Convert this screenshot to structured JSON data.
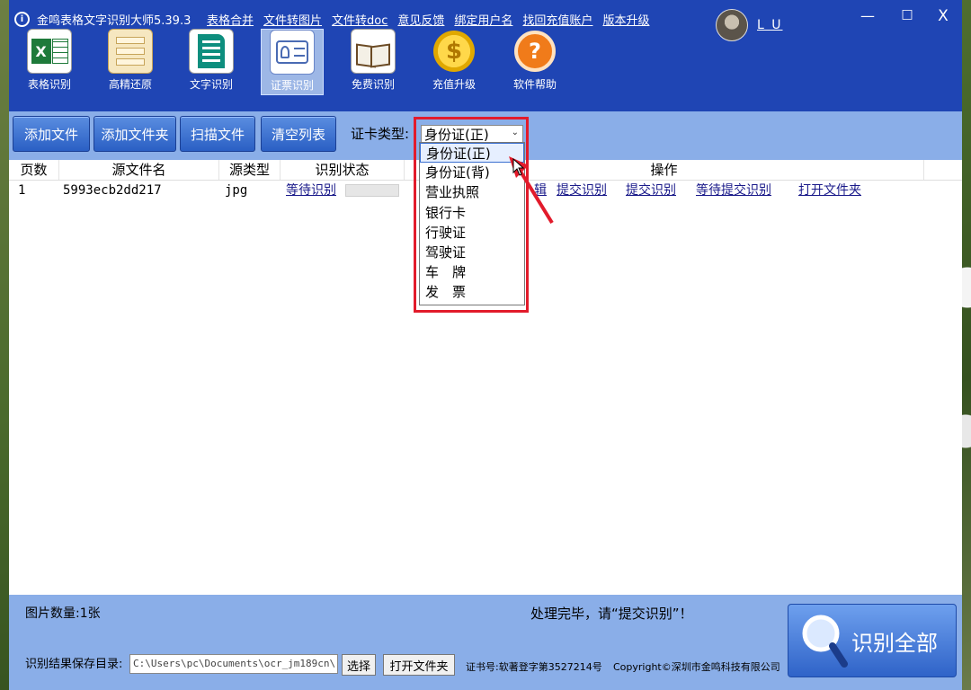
{
  "app": {
    "title": "金鸣表格文字识别大师5.39.3",
    "logo_glyph": "i"
  },
  "menu_links": [
    "表格合并",
    "文件转图片",
    "文件转doc",
    "意见反馈",
    "绑定用户名",
    "找回充值账户",
    "版本升级"
  ],
  "user": {
    "name": "L U"
  },
  "window_controls": {
    "minimize": "—",
    "maximize": "□",
    "close": "X"
  },
  "tools": [
    {
      "label": "表格识别",
      "icon": "excel-icon"
    },
    {
      "label": "高精还原",
      "icon": "document-restore-icon"
    },
    {
      "label": "文字识别",
      "icon": "text-document-icon"
    },
    {
      "label": "证票识别",
      "icon": "id-card-icon",
      "active": true
    },
    {
      "label": "免费识别",
      "icon": "open-book-icon"
    },
    {
      "label": "充值升级",
      "icon": "coin-icon",
      "glyph": "$"
    },
    {
      "label": "软件帮助",
      "icon": "help-icon",
      "glyph": "?"
    }
  ],
  "toolbar": {
    "add_file": "添加文件",
    "add_folder": "添加文件夹",
    "scan_file": "扫描文件",
    "clear_list": "清空列表",
    "card_type_label": "证卡类型:",
    "card_type_value": "身份证(正)"
  },
  "table": {
    "headers": [
      "页数",
      "源文件名",
      "源类型",
      "识别状态",
      "操作"
    ],
    "rows": [
      {
        "page": "1",
        "filename": "5993ecb2dd217",
        "type": "jpg",
        "status": "等待识别",
        "actions": [
          "辑",
          "提交识别",
          "提交识别",
          "等待提交识别",
          "打开文件夹"
        ]
      }
    ]
  },
  "dropdown": {
    "options": [
      "身份证(正)",
      "身份证(背)",
      "营业执照",
      "银行卡",
      "行驶证",
      "驾驶证",
      "车　牌",
      "发　票"
    ],
    "selected_index": 0
  },
  "footer": {
    "image_count": "图片数量:1张",
    "status_message": "处理完毕，请“提交识别”！",
    "save_dir_label": "识别结果保存目录:",
    "save_dir_value": "C:\\Users\\pc\\Documents\\ocr_jm189cn\\",
    "choose": "选择",
    "open_folder": "打开文件夹",
    "cert": "证书号:软著登字第3527214号",
    "copyright": "Copyright©深圳市金鸣科技有限公司",
    "recognize_all": "识别全部"
  },
  "colors": {
    "titlebar": "#1f45b4",
    "toolbar": "#8aaee8",
    "highlight": "#e21b2b"
  }
}
